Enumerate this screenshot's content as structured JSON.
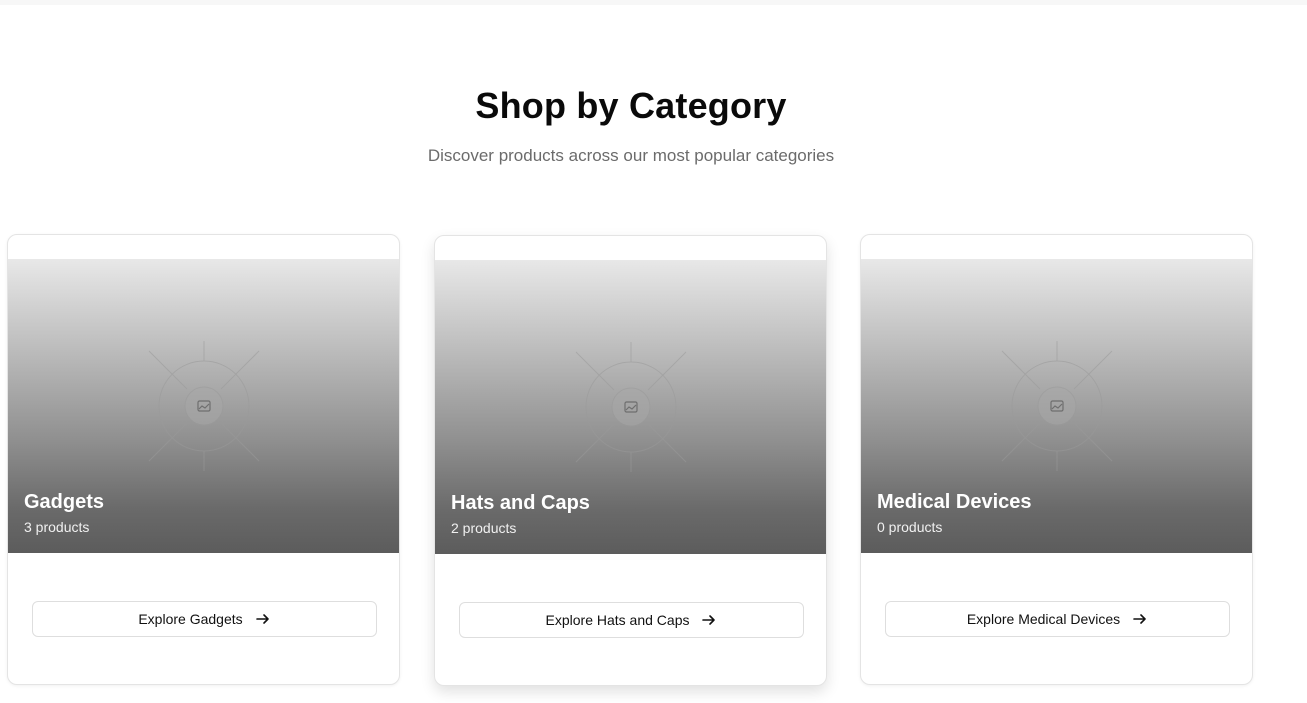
{
  "section": {
    "title": "Shop by Category",
    "subtitle": "Discover products across our most popular categories"
  },
  "categories": [
    {
      "name": "Gadgets",
      "count_label": "3 products",
      "button_label": "Explore Gadgets",
      "icon": "image-placeholder-icon"
    },
    {
      "name": "Hats and Caps",
      "count_label": "2 products",
      "button_label": "Explore Hats and Caps",
      "icon": "image-placeholder-icon"
    },
    {
      "name": "Medical Devices",
      "count_label": "0 products",
      "button_label": "Explore Medical Devices",
      "icon": "image-placeholder-icon"
    }
  ],
  "colors": {
    "heading": "#0a0a0a",
    "subtitle": "#6b6b6b",
    "card_border": "#e4e4e4",
    "overlay_text": "#ffffff"
  }
}
